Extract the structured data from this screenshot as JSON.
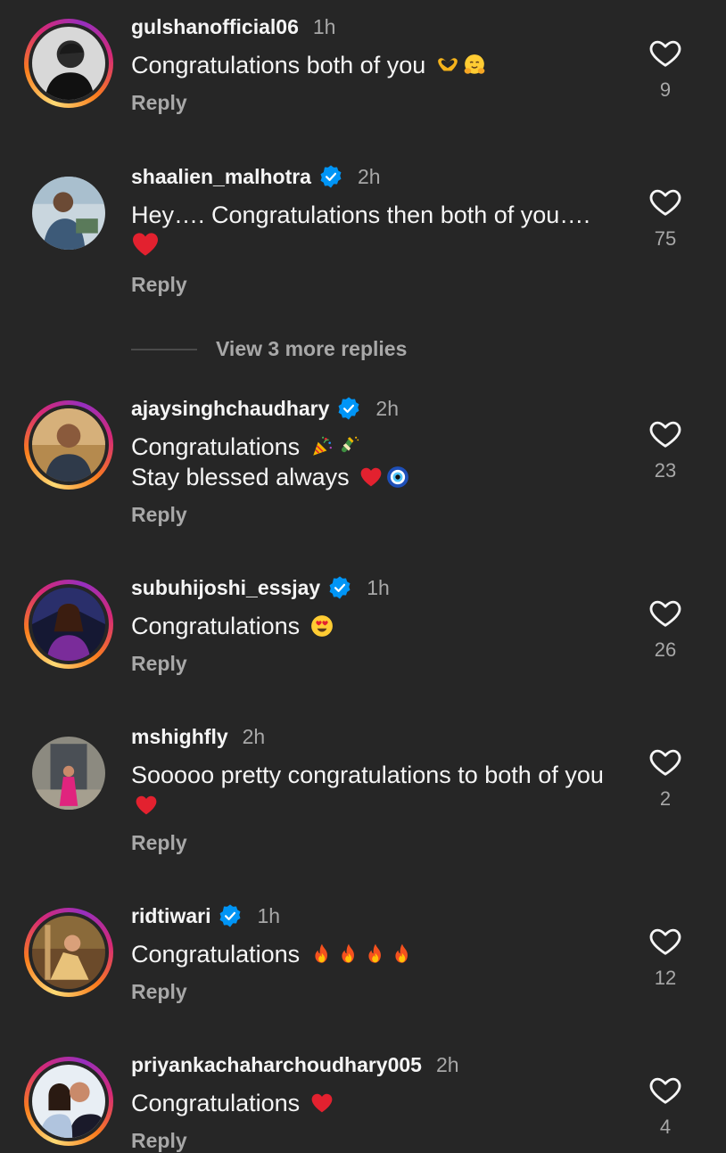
{
  "comments": [
    {
      "username": "gulshanofficial06",
      "verified": false,
      "time": "1h",
      "text": "Congratulations both of you",
      "emoji_icons": [
        "heart-hands-icon",
        "hugging-face-icon"
      ],
      "reply": "Reply",
      "likes": "9",
      "ring": true
    },
    {
      "username": "shaalien_malhotra",
      "verified": true,
      "time": "2h",
      "text": "Hey…. Congratulations then both of you….",
      "emoji_icons": [
        "red-heart-icon"
      ],
      "reply": "Reply",
      "likes": "75",
      "ring": false
    },
    {
      "username": "ajaysinghchaudhary",
      "verified": true,
      "time": "2h",
      "text": "Congratulations",
      "text2": "Stay blessed always",
      "emoji_icons": [
        "party-popper-icon",
        "champagne-icon",
        "red-heart-icon",
        "nazar-amulet-icon"
      ],
      "reply": "Reply",
      "likes": "23",
      "ring": true
    },
    {
      "username": "subuhijoshi_essjay",
      "verified": true,
      "time": "1h",
      "text": "Congratulations",
      "emoji_icons": [
        "heart-eyes-icon"
      ],
      "reply": "Reply",
      "likes": "26",
      "ring": true
    },
    {
      "username": "mshighfly",
      "verified": false,
      "time": "2h",
      "text": "Sooooo pretty congratulations to both of you",
      "emoji_icons": [
        "red-heart-icon"
      ],
      "reply": "Reply",
      "likes": "2",
      "ring": false
    },
    {
      "username": "ridtiwari",
      "verified": true,
      "time": "1h",
      "text": "Congratulations",
      "emoji_icons": [
        "fire-icon",
        "fire-icon",
        "fire-icon",
        "fire-icon"
      ],
      "reply": "Reply",
      "likes": "12",
      "ring": true
    },
    {
      "username": "priyankachaharchoudhary005",
      "verified": false,
      "time": "2h",
      "text": "Congratulations",
      "emoji_icons": [
        "red-heart-icon"
      ],
      "reply": "Reply",
      "likes": "4",
      "ring": true
    }
  ],
  "view_more_replies": "View 3 more replies",
  "colors": {
    "background": "#262626",
    "text": "#f5f5f5",
    "muted": "#a8a8a8",
    "verified": "#0095f6",
    "heart": "#ed4956"
  }
}
